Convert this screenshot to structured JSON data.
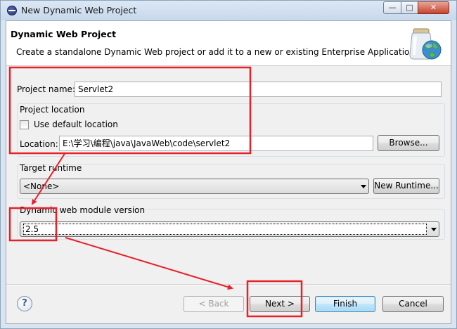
{
  "window": {
    "title": "New Dynamic Web Project",
    "controls": {
      "minimize": "—",
      "maximize": "□",
      "close": "✕"
    }
  },
  "banner": {
    "title": "Dynamic Web Project",
    "description": "Create a standalone Dynamic Web project or add it to a new or existing Enterprise Application.",
    "icon": "web-project-jar-globe-icon"
  },
  "project": {
    "name_label": "Project name:",
    "name_value": "Servlet2",
    "location_group_label": "Project location",
    "use_default_checkbox": {
      "label": "Use default location",
      "checked": false
    },
    "location_label": "Location:",
    "location_value": "E:\\学习\\编程\\java\\JavaWeb\\code\\servlet2",
    "browse_button": "Browse..."
  },
  "target_runtime": {
    "label": "Target runtime",
    "selected": "<None>",
    "new_runtime_button": "New Runtime..."
  },
  "module_version": {
    "label": "Dynamic web module version",
    "selected": "2.5"
  },
  "footer": {
    "help_icon": "help-question-icon",
    "back_button": "< Back",
    "next_button": "Next >",
    "finish_button": "Finish",
    "cancel_button": "Cancel"
  },
  "colors": {
    "annotation_red": "#e8202a",
    "title_bar": "#dbe7f5",
    "client_bg": "#f0f0f0",
    "default_button_border": "#3c7fb1"
  }
}
